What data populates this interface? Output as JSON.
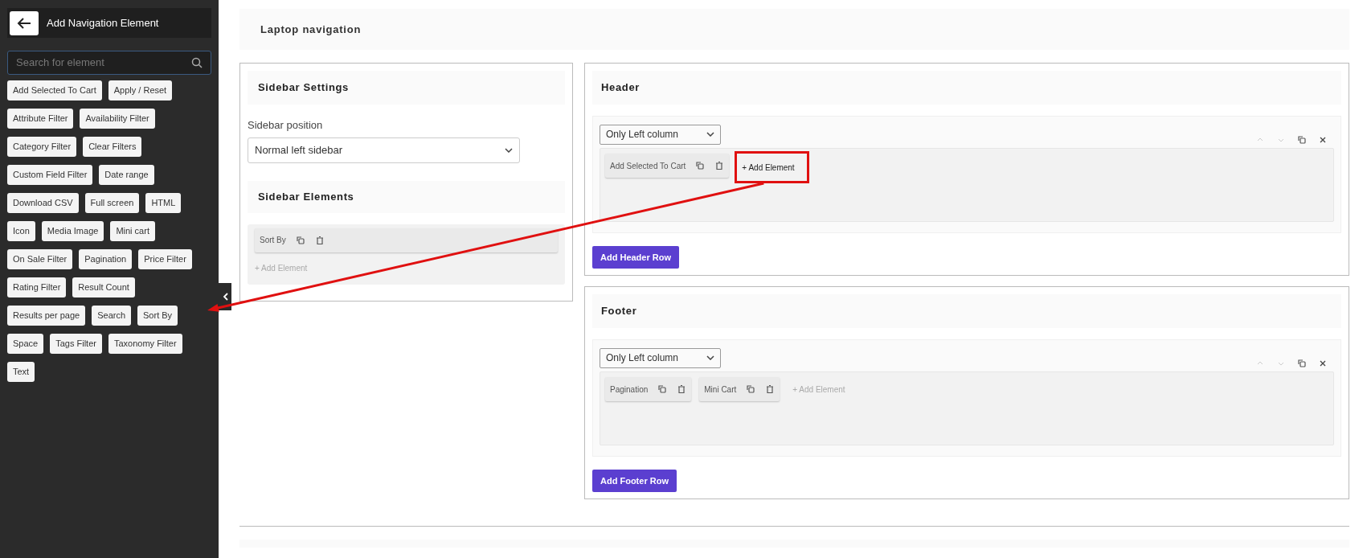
{
  "sidebar": {
    "title": "Add Navigation Element",
    "search": {
      "placeholder": "Search for element"
    },
    "elements": [
      "Add Selected To Cart",
      "Apply / Reset",
      "Attribute Filter",
      "Availability Filter",
      "Category Filter",
      "Clear Filters",
      "Custom Field Filter",
      "Date range",
      "Download CSV",
      "Full screen",
      "HTML",
      "Icon",
      "Media Image",
      "Mini cart",
      "On Sale Filter",
      "Pagination",
      "Price Filter",
      "Rating Filter",
      "Result Count",
      "Results per page",
      "Search",
      "Sort By",
      "Space",
      "Tags Filter",
      "Taxonomy Filter",
      "Text"
    ]
  },
  "page_title": "Laptop navigation",
  "sidebar_settings": {
    "title": "Sidebar Settings",
    "position_label": "Sidebar position",
    "position_value": "Normal left sidebar",
    "elements_title": "Sidebar Elements",
    "elements": [
      "Sort By"
    ],
    "add_label": "+ Add Element"
  },
  "sections": [
    {
      "title": "Header",
      "rows": [
        {
          "layout": "Only Left column",
          "elements": [
            "Add Selected To Cart"
          ],
          "add_label": "+ Add Element",
          "highlighted": true
        }
      ],
      "add_row": "Add Header Row"
    },
    {
      "title": "Footer",
      "rows": [
        {
          "layout": "Only Left column",
          "elements": [
            "Pagination",
            "Mini Cart"
          ],
          "add_label": "+ Add Element",
          "highlighted": false
        }
      ],
      "add_row": "Add Footer Row"
    }
  ]
}
